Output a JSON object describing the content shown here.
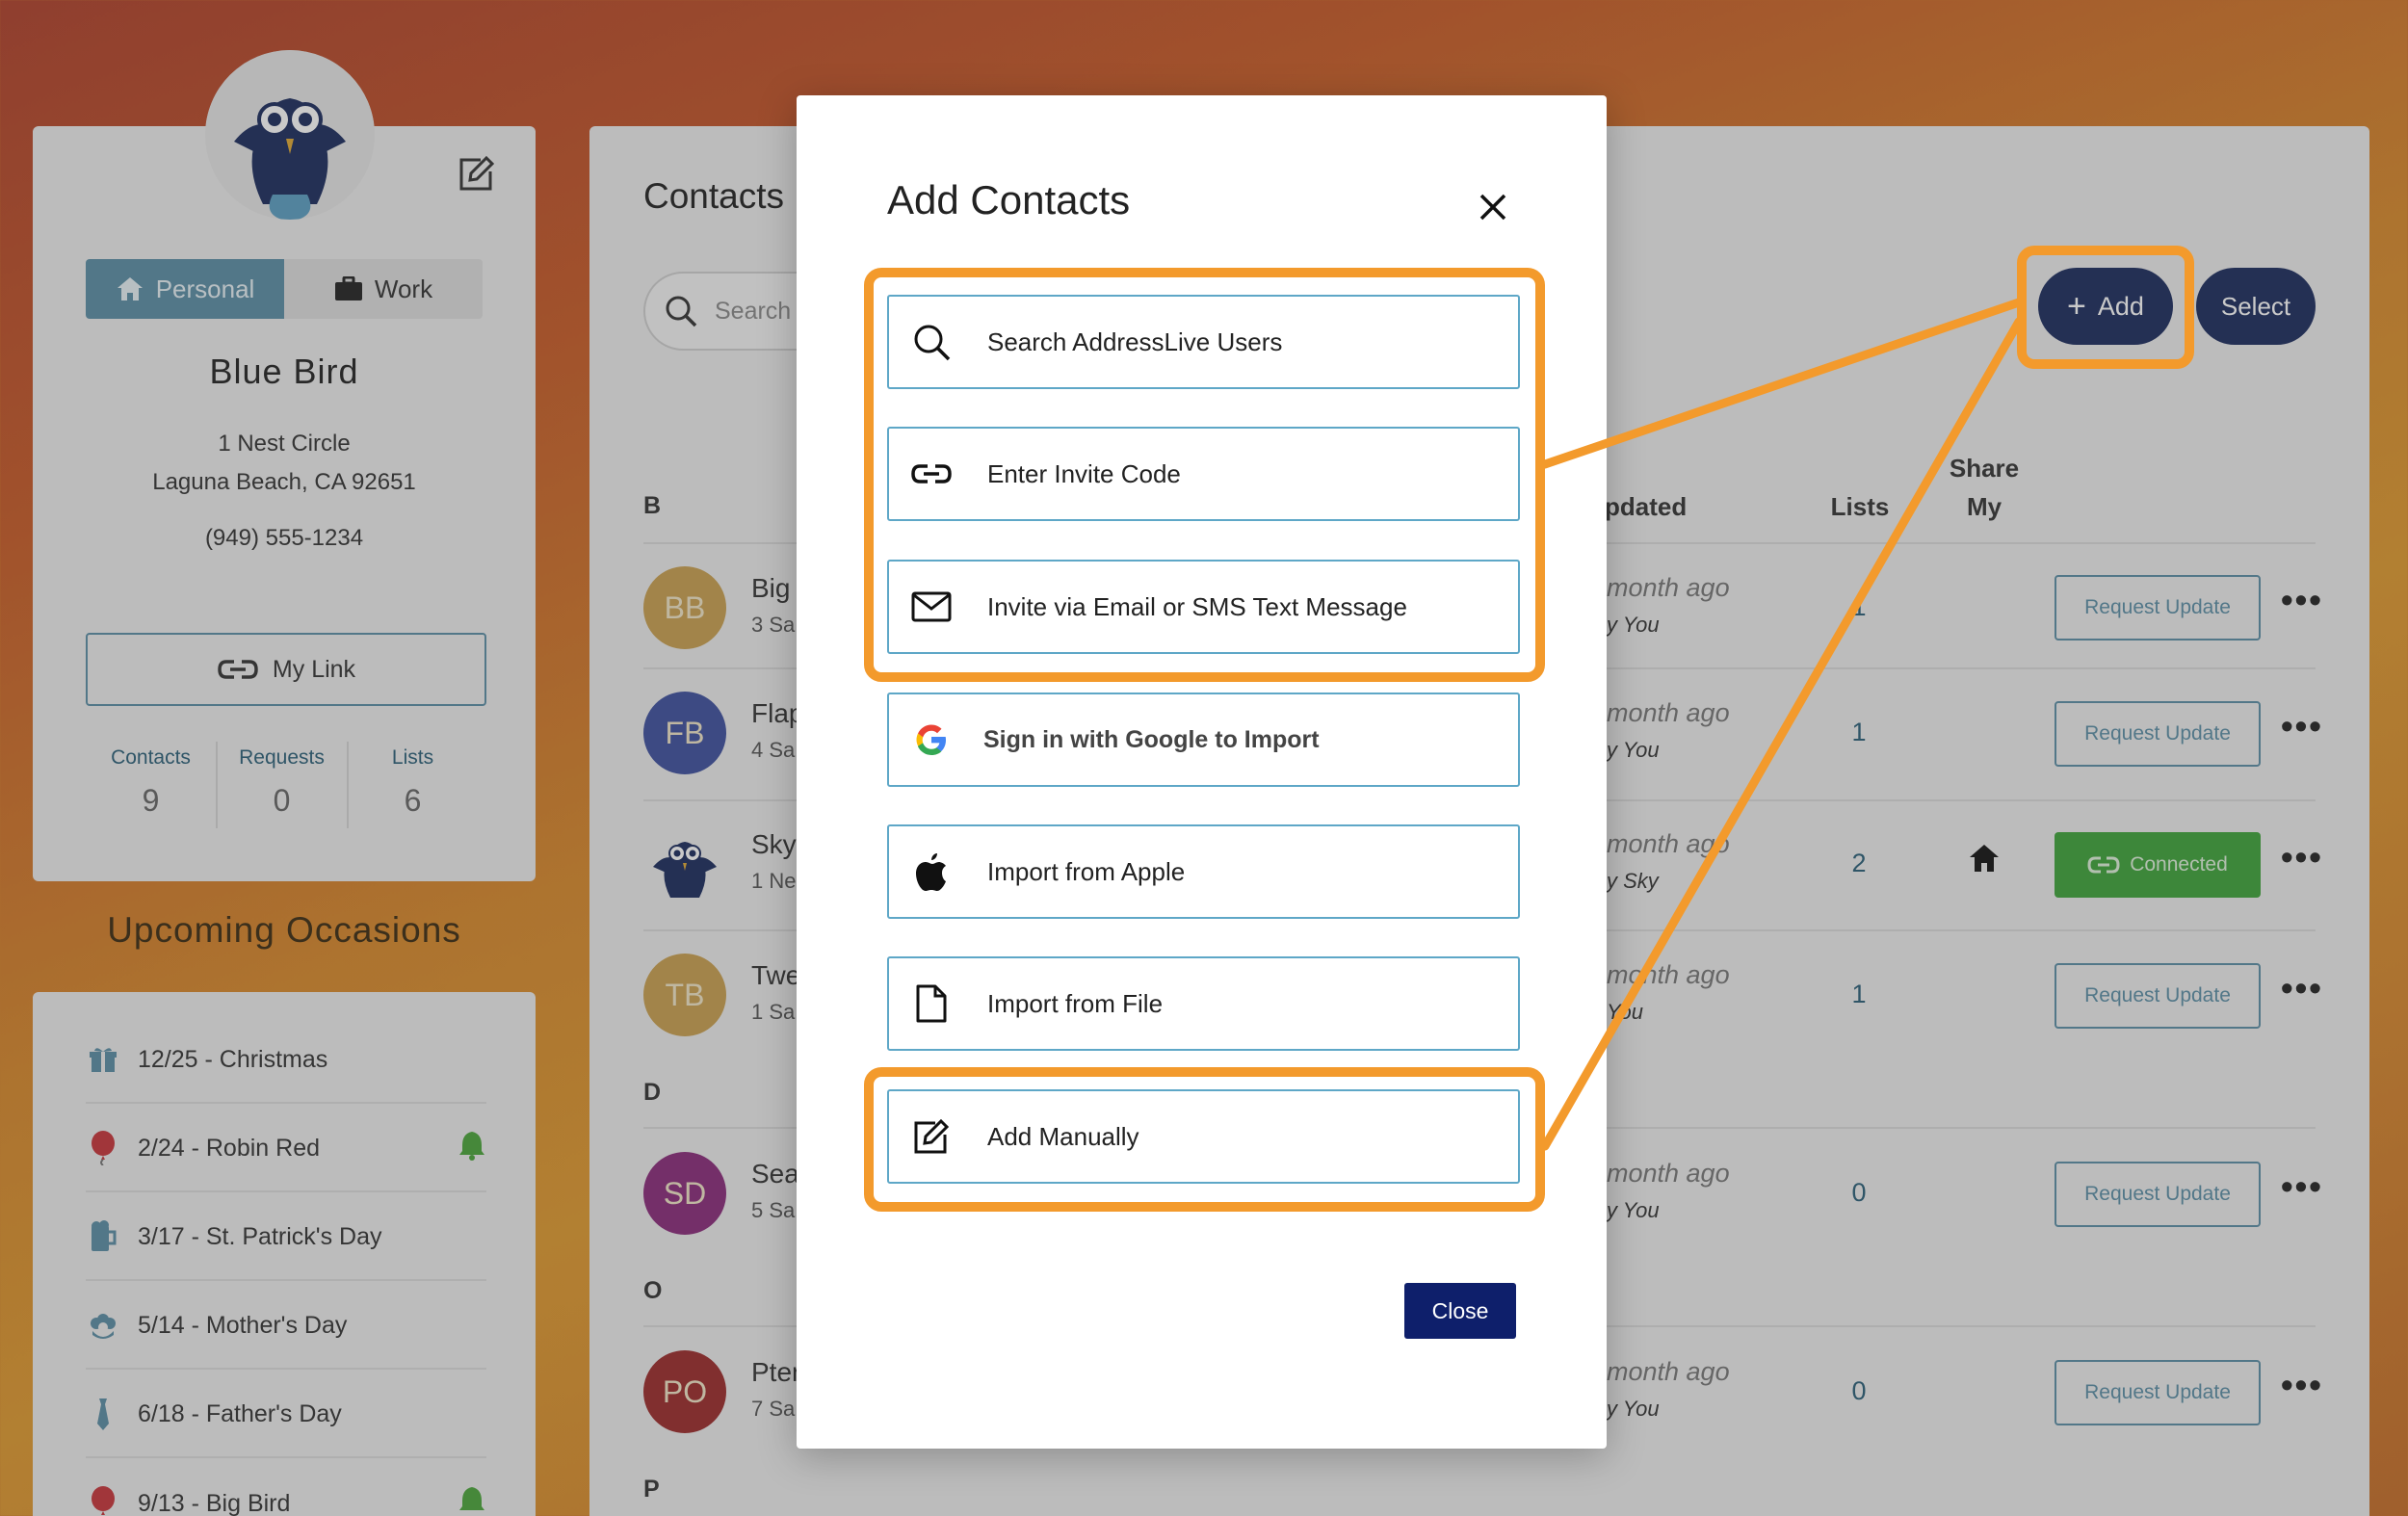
{
  "profile": {
    "segments": {
      "personal": "Personal",
      "work": "Work"
    },
    "name": "Blue Bird",
    "address_line1": "1 Nest Circle",
    "address_line2": "Laguna Beach, CA 92651",
    "phone": "(949) 555-1234",
    "my_link_label": "My Link",
    "stats": [
      {
        "label": "Contacts",
        "value": "9"
      },
      {
        "label": "Requests",
        "value": "0"
      },
      {
        "label": "Lists",
        "value": "6"
      }
    ]
  },
  "occasions": {
    "title": "Upcoming Occasions",
    "items": [
      {
        "label": "12/25 - Christmas",
        "icon": "gift-icon",
        "bell": false
      },
      {
        "label": "2/24 - Robin Red",
        "icon": "balloon-icon",
        "bell": true
      },
      {
        "label": "3/17 - St. Patrick's Day",
        "icon": "beer-icon",
        "bell": false
      },
      {
        "label": "5/14 - Mother's Day",
        "icon": "flower-icon",
        "bell": false
      },
      {
        "label": "6/18 - Father's Day",
        "icon": "tie-icon",
        "bell": false
      },
      {
        "label": "9/13 - Big Bird",
        "icon": "balloon-icon",
        "bell": true
      }
    ]
  },
  "main": {
    "title": "Contacts",
    "search_placeholder": "Search",
    "add_label": "Add",
    "select_label": "Select",
    "columns": {
      "updated": "pdated",
      "lists": "Lists",
      "share_line1": "Share",
      "share_line2": "My"
    },
    "letters": [
      "B",
      "D",
      "O",
      "P"
    ],
    "rows": [
      {
        "initials": "BB",
        "color": "#c9a04f",
        "name": "Big",
        "sub": "3 Sa",
        "updated": "month ago",
        "by": "y You",
        "lists": "1",
        "action": "Request Update"
      },
      {
        "initials": "FB",
        "color": "#3d4f9e",
        "name": "Flap",
        "sub": "4 Sa",
        "updated": "month ago",
        "by": "y You",
        "lists": "1",
        "action": "Request Update"
      },
      {
        "initials": "",
        "color": "#1b2b5e",
        "name": "Sky",
        "sub": "1 Ne",
        "updated": "month ago",
        "by": "y Sky",
        "lists": "2",
        "action": "Connected"
      },
      {
        "initials": "TB",
        "color": "#c9a04f",
        "name": "Twe",
        "sub": "1 Sa",
        "updated": "month ago",
        "by": "You",
        "lists": "1",
        "action": "Request Update"
      },
      {
        "initials": "SD",
        "color": "#8a2a7a",
        "name": "Sea",
        "sub": "5 Sa",
        "updated": "month ago",
        "by": "y You",
        "lists": "0",
        "action": "Request Update"
      },
      {
        "initials": "PO",
        "color": "#9b2a2a",
        "name": "Pter",
        "sub": "7 Sa",
        "updated": "month ago",
        "by": "y You",
        "lists": "0",
        "action": "Request Update"
      }
    ]
  },
  "modal": {
    "title": "Add Contacts",
    "options": [
      {
        "label": "Search AddressLive Users",
        "icon": "search-icon"
      },
      {
        "label": "Enter Invite Code",
        "icon": "link-icon"
      },
      {
        "label": "Invite via Email or SMS Text Message",
        "icon": "envelope-icon"
      },
      {
        "label": "Sign in with Google to Import",
        "icon": "google-icon"
      },
      {
        "label": "Import from Apple",
        "icon": "apple-icon"
      },
      {
        "label": "Import from File",
        "icon": "file-icon"
      },
      {
        "label": "Add Manually",
        "icon": "edit-icon"
      }
    ],
    "close_label": "Close"
  },
  "colors": {
    "highlight": "#f39a2c",
    "navy": "#1b2b5e",
    "accent": "#5b8ea6",
    "connected": "#3ea43a"
  }
}
